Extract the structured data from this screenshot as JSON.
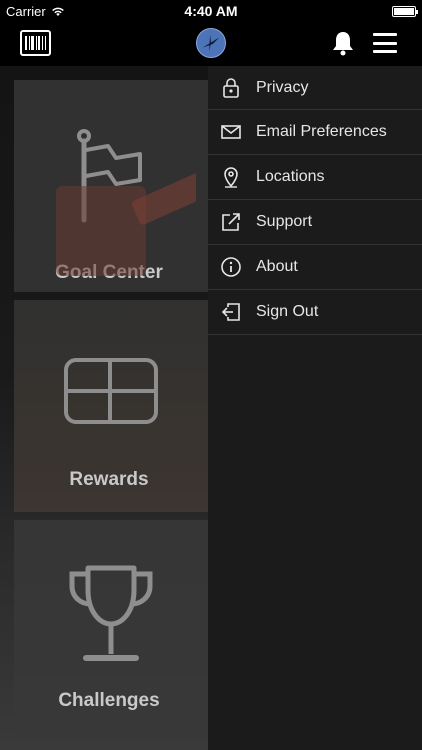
{
  "status_bar": {
    "carrier": "Carrier",
    "time": "4:40 AM"
  },
  "nav": {
    "left_icon": "barcode-card-icon",
    "center_icon": "brand-logo-icon",
    "bell_icon": "bell-icon",
    "menu_icon": "hamburger-menu-icon"
  },
  "tiles": [
    {
      "label": "Goal Center",
      "icon": "flag-icon"
    },
    {
      "label": "Rewards",
      "icon": "ticket-icon"
    },
    {
      "label": "Challenges",
      "icon": "trophy-icon"
    }
  ],
  "drawer": {
    "items": [
      {
        "label": "Privacy",
        "icon": "lock-icon"
      },
      {
        "label": "Email Preferences",
        "icon": "envelope-icon"
      },
      {
        "label": "Locations",
        "icon": "map-pin-icon"
      },
      {
        "label": "Support",
        "icon": "external-link-icon"
      },
      {
        "label": "About",
        "icon": "info-icon"
      },
      {
        "label": "Sign Out",
        "icon": "sign-out-icon"
      }
    ]
  },
  "colors": {
    "background": "#000000",
    "tile": "#313131",
    "drawer": "#1b1b1b",
    "logo": "#4d74b8",
    "label": "#c9c9c9"
  }
}
